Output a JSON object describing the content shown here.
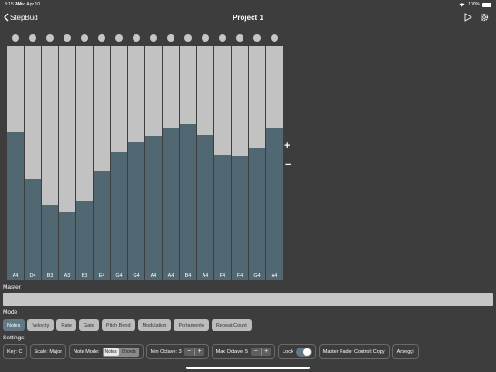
{
  "status": {
    "time": "3:15 PM",
    "date": "Wed Apr 10",
    "battery": "100%"
  },
  "nav": {
    "back_label": "StepBud",
    "title": "Project 1"
  },
  "steps": [
    {
      "note": "A4",
      "level": 0.63
    },
    {
      "note": "D4",
      "level": 0.435
    },
    {
      "note": "B3",
      "level": 0.32
    },
    {
      "note": "A3",
      "level": 0.29
    },
    {
      "note": "B3",
      "level": 0.34
    },
    {
      "note": "E4",
      "level": 0.47
    },
    {
      "note": "G4",
      "level": 0.55
    },
    {
      "note": "G4",
      "level": 0.59
    },
    {
      "note": "A4",
      "level": 0.615
    },
    {
      "note": "A4",
      "level": 0.65
    },
    {
      "note": "B4",
      "level": 0.665
    },
    {
      "note": "A4",
      "level": 0.62
    },
    {
      "note": "F4",
      "level": 0.535
    },
    {
      "note": "F4",
      "level": 0.53
    },
    {
      "note": "G4",
      "level": 0.565
    },
    {
      "note": "A4",
      "level": 0.65
    }
  ],
  "labels": {
    "master": "Master",
    "mode": "Mode",
    "settings": "Settings",
    "plus": "+",
    "minus": "−"
  },
  "modes": [
    "Notes",
    "Velocity",
    "Rate",
    "Gate",
    "Pitch Bend",
    "Modulation",
    "Portamento",
    "Repeat Count"
  ],
  "settings": {
    "key": "Key: C",
    "scale": "Scale: Major",
    "note_mode_label": "Note Mode:",
    "note_mode_options": [
      "Notes",
      "Chords"
    ],
    "min_octave": "Min Octave: 3",
    "max_octave": "Max Octave: 5",
    "lock": "Lock",
    "master_fader": "Master Fader Control: Copy",
    "arpeggio": "Arpeggi"
  },
  "colors": {
    "background": "#3d3d3d",
    "fader_fill": "#516772",
    "fader_track": "#c2c2c2",
    "accent": "#627985"
  }
}
